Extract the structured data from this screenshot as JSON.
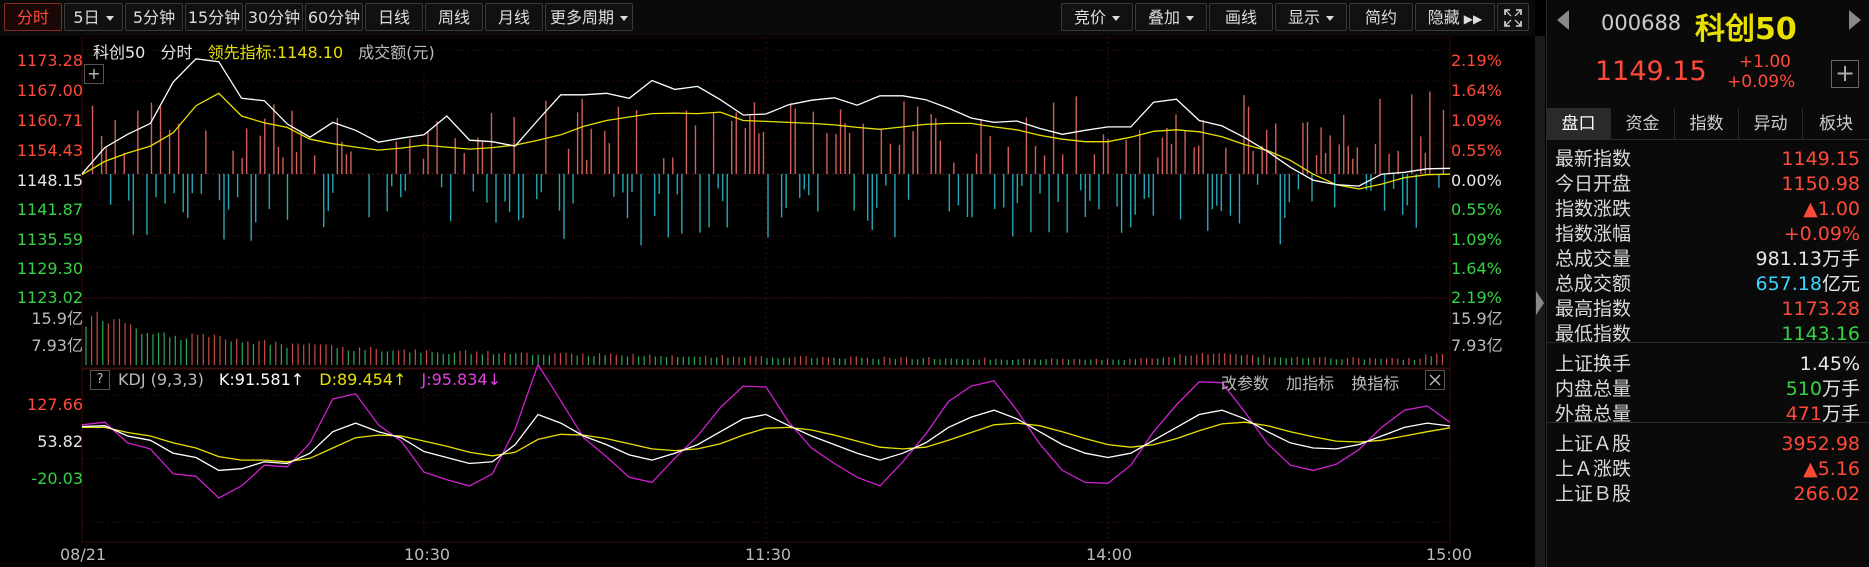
{
  "toolbar": {
    "left": [
      {
        "label": "分时",
        "active": true
      },
      {
        "label": "5日",
        "dropdown": true
      },
      {
        "label": "5分钟"
      },
      {
        "label": "15分钟"
      },
      {
        "label": "30分钟"
      },
      {
        "label": "60分钟"
      },
      {
        "label": "日线"
      },
      {
        "label": "周线"
      },
      {
        "label": "月线"
      },
      {
        "label": "更多周期",
        "dropdown": true
      }
    ],
    "right": [
      {
        "label": "竞价",
        "dropdown": true
      },
      {
        "label": "叠加",
        "dropdown": true
      },
      {
        "label": "画线"
      },
      {
        "label": "显示",
        "dropdown": true
      },
      {
        "label": "简约"
      },
      {
        "label": "隐藏"
      }
    ]
  },
  "legend": {
    "name": "科创50",
    "mode": "分时",
    "lead_label": "领先指标:",
    "lead_value": "1148.10",
    "volume_label": "成交额(元)"
  },
  "price_axis": {
    "left": [
      "1173.28",
      "1167.00",
      "1160.71",
      "1154.43",
      "1148.15",
      "1141.87",
      "1135.59",
      "1129.30",
      "1123.02"
    ],
    "right": [
      "2.19%",
      "1.64%",
      "1.09%",
      "0.55%",
      "0.00%",
      "0.55%",
      "1.09%",
      "1.64%",
      "2.19%"
    ]
  },
  "volume_axis": {
    "left": [
      "15.9亿",
      "7.93亿"
    ],
    "right": [
      "15.9亿",
      "7.93亿"
    ]
  },
  "kdj": {
    "help": "?",
    "name": "KDJ (9,3,3)",
    "k_label": "K:91.581↑",
    "d_label": "D:89.454↑",
    "j_label": "J:95.834↓",
    "actions": [
      "改参数",
      "加指标",
      "换指标"
    ],
    "axis": [
      "127.66",
      "53.82",
      "-20.03"
    ]
  },
  "time_axis": [
    "08/21",
    "10:30",
    "11:30",
    "14:00",
    "15:00"
  ],
  "chart_data": {
    "type": "line",
    "series": [
      {
        "name": "科创50",
        "values": [
          1148.2,
          1153.5,
          1156.2,
          1158.4,
          1166.8,
          1171.5,
          1170.9,
          1163.5,
          1163.0,
          1158.3,
          1155.6,
          1158.6,
          1157.0,
          1154.6,
          1155.4,
          1156.1,
          1159.9,
          1155.0,
          1154.7,
          1153.8,
          1159.1,
          1164.2,
          1164.2,
          1164.5,
          1163.5,
          1167.1,
          1165.3,
          1165.9,
          1163.2,
          1160.1,
          1160.3,
          1162.2,
          1163.1,
          1163.6,
          1162.1,
          1164.0,
          1164.0,
          1163.2,
          1161.5,
          1159.5,
          1158.6,
          1158.9,
          1157.4,
          1156.2,
          1157.0,
          1157.7,
          1157.7,
          1162.7,
          1163.3,
          1159.0,
          1157.9,
          1155.5,
          1152.7,
          1149.5,
          1146.9,
          1146.0,
          1145.7,
          1148.1,
          1148.5,
          1149.2,
          1149.3
        ]
      },
      {
        "name": "领先指标",
        "values": [
          1148.0,
          1150.7,
          1152.4,
          1153.8,
          1156.5,
          1162.0,
          1164.5,
          1159.9,
          1158.5,
          1157.6,
          1155.2,
          1154.3,
          1153.6,
          1153.0,
          1153.4,
          1154.0,
          1153.6,
          1153.2,
          1153.5,
          1154.0,
          1155.0,
          1156.1,
          1157.8,
          1159.0,
          1159.7,
          1160.4,
          1160.5,
          1160.4,
          1160.7,
          1159.0,
          1158.8,
          1158.6,
          1158.4,
          1158.1,
          1157.6,
          1157.2,
          1157.7,
          1158.2,
          1158.4,
          1158.4,
          1157.7,
          1157.1,
          1156.0,
          1155.2,
          1154.7,
          1154.7,
          1155.6,
          1156.8,
          1157.1,
          1156.7,
          1155.7,
          1154.1,
          1152.9,
          1150.9,
          1148.1,
          1146.0,
          1145.1,
          1146.1,
          1147.4,
          1148.0,
          1148.1
        ]
      }
    ],
    "ylim": [
      1123.02,
      1173.28
    ],
    "yref": 1148.15,
    "volume_values": [
      15.9,
      14.0,
      12.6,
      11.3,
      10.2,
      9.4,
      8.6,
      7.9,
      7.3,
      6.8,
      6.3,
      5.9,
      5.5,
      5.2,
      4.9,
      4.7,
      4.5,
      4.3,
      4.1,
      4.0,
      3.8,
      3.6,
      3.5,
      3.4,
      3.3,
      3.2,
      3.1,
      3.0,
      2.9,
      2.8,
      2.7,
      2.7,
      2.6,
      2.5,
      2.5,
      2.4,
      2.4,
      2.3,
      2.3,
      2.2,
      2.2,
      2.1,
      2.1,
      2.1,
      2.0,
      2.0,
      2.0,
      2.2,
      2.6,
      3.2,
      3.6,
      3.4,
      3.0,
      2.8,
      2.6,
      2.4,
      2.3,
      2.2,
      2.1,
      2.1,
      3.3
    ],
    "volume_ylim": [
      0,
      15.9
    ],
    "kdj": {
      "K": [
        91,
        92,
        80,
        75,
        60,
        55,
        40,
        42,
        50,
        48,
        60,
        85,
        95,
        85,
        78,
        62,
        55,
        48,
        50,
        70,
        105,
        95,
        80,
        70,
        58,
        52,
        60,
        70,
        85,
        100,
        105,
        92,
        80,
        70,
        60,
        52,
        60,
        72,
        90,
        102,
        110,
        100,
        85,
        70,
        60,
        55,
        60,
        75,
        90,
        105,
        110,
        100,
        85,
        72,
        66,
        65,
        70,
        80,
        90,
        95,
        91.6
      ],
      "D": [
        90,
        90,
        84,
        80,
        72,
        66,
        56,
        52,
        52,
        50,
        54,
        66,
        78,
        81,
        80,
        74,
        68,
        61,
        57,
        61,
        76,
        82,
        81,
        77,
        71,
        65,
        63,
        65,
        71,
        81,
        89,
        90,
        87,
        81,
        74,
        67,
        65,
        67,
        75,
        84,
        93,
        95,
        92,
        85,
        77,
        70,
        67,
        70,
        77,
        86,
        94,
        96,
        92,
        85,
        79,
        74,
        73,
        75,
        80,
        85,
        89.5
      ],
      "J": [
        93,
        96,
        72,
        65,
        36,
        33,
        8,
        22,
        46,
        44,
        72,
        123,
        129,
        93,
        74,
        38,
        29,
        22,
        36,
        88,
        163,
        121,
        78,
        56,
        32,
        26,
        54,
        80,
        113,
        138,
        137,
        96,
        66,
        48,
        32,
        22,
        50,
        82,
        120,
        138,
        144,
        110,
        71,
        40,
        26,
        25,
        46,
        85,
        116,
        143,
        142,
        108,
        71,
        46,
        40,
        47,
        64,
        90,
        110,
        115,
        95.8
      ],
      "ylim": [
        -20.03,
        127.66
      ]
    }
  },
  "panel": {
    "code": "000688",
    "name": "科创50",
    "price": "1149.15",
    "change": "+1.00",
    "change_pct": "+0.09%",
    "tabs": [
      "盘口",
      "资金",
      "指数",
      "异动",
      "板块"
    ],
    "rows": [
      {
        "k": "最新指数",
        "v": "1149.15",
        "c": "#ff4a3a"
      },
      {
        "k": "今日开盘",
        "v": "1150.98",
        "c": "#ff4a3a"
      },
      {
        "k": "指数涨跌",
        "v": "▲1.00",
        "c": "#ff4a3a"
      },
      {
        "k": "指数涨幅",
        "v": "+0.09%",
        "c": "#ff4a3a"
      },
      {
        "k": "总成交量",
        "v": "981.13",
        "u": "万手",
        "c": "#e6e6e6"
      },
      {
        "k": "总成交额",
        "v": "657.18",
        "u": "亿元",
        "c": "#3ad7ff"
      },
      {
        "k": "最高指数",
        "v": "1173.28",
        "c": "#ff4a3a"
      },
      {
        "k": "最低指数",
        "v": "1143.16",
        "c": "#36d246"
      },
      {
        "k": "上证换手",
        "v": "1.45%",
        "c": "#e6e6e6"
      },
      {
        "k": "内盘总量",
        "v": "510",
        "u": "万手",
        "c": "#36d246"
      },
      {
        "k": "外盘总量",
        "v": "471",
        "u": "万手",
        "c": "#ff4a3a"
      },
      {
        "k": "上证Ａ股",
        "v": "3952.98",
        "c": "#ff4a3a"
      },
      {
        "k": "上Ａ涨跌",
        "v": "▲5.16",
        "c": "#ff4a3a"
      },
      {
        "k": "上证Ｂ股",
        "v": "266.02",
        "c": "#ff4a3a"
      }
    ]
  },
  "colors": {
    "up": "#ff4a3a",
    "down": "#36d246",
    "price_line": "#ffffff",
    "lead_line": "#e8e000",
    "bar_up": "#d0605a",
    "bar_down": "#26a8b8",
    "k": "#ffffff",
    "d": "#e8e000",
    "j": "#d020d0"
  }
}
